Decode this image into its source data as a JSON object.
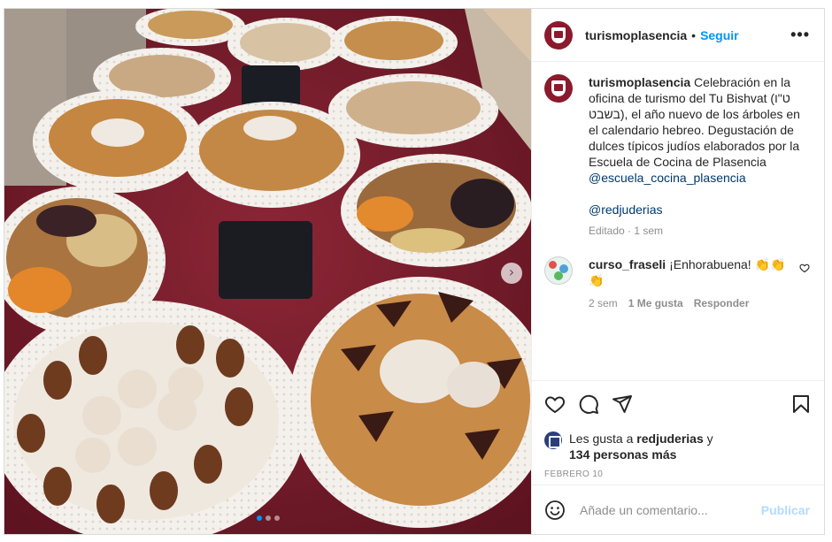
{
  "post": {
    "username": "turismoplasencia",
    "separator": "•",
    "follow_label": "Seguir",
    "more_label": "•••",
    "caption_user": "turismoplasencia",
    "caption_text": "Celebración en la oficina de turismo del Tu Bishvat (ט\"ו בשבט), el año nuevo de los árboles en el calendario hebreo. Degustación de dulces típicos judíos elaborados por la Escuela de Cocina de Plasencia",
    "mention_1": "@escuela_cocina_plasencia",
    "mention_2": "@redjuderias",
    "caption_meta": "Editado · 1 sem",
    "icons": {
      "like": "heart-icon",
      "comment": "comment-icon",
      "share": "share-icon",
      "save": "bookmark-icon",
      "emoji": "emoji-icon",
      "next": "chevron-right-icon"
    },
    "carousel": {
      "slide_count": 3,
      "active_slide": 1
    }
  },
  "comment": {
    "user": "curso_fraseli",
    "text": "¡Enhorabuena! 👏👏👏",
    "time": "2 sem",
    "likes": "1 Me gusta",
    "reply": "Responder"
  },
  "likes": {
    "prefix": "Les gusta a ",
    "user": "redjuderias",
    "suffix": " y",
    "others": "134 personas más"
  },
  "date": "FEBRERO 10",
  "composer": {
    "placeholder": "Añade un comentario...",
    "publish": "Publicar"
  },
  "colors": {
    "accent": "#0095f6",
    "brand_avatar": "#8a1a2c",
    "tablecloth": "#7a1e2c",
    "publish_disabled": "#b3dbff"
  }
}
